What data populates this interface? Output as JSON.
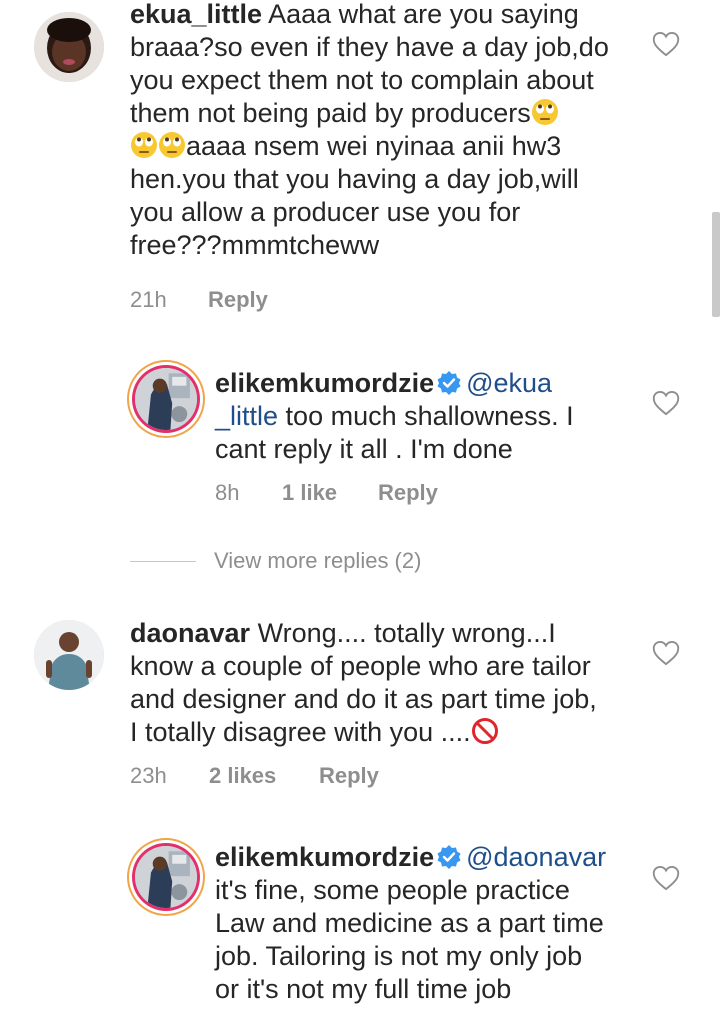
{
  "comments": [
    {
      "username": "ekua_little",
      "text_lines": [
        "Aaaa what are you saying",
        "braaa?so even if they have a day job,do",
        "you expect them not to complain about",
        "them not being paid by producers"
      ],
      "text_lines_2": [
        "aaaa nsem wei nyinaa anii hw3",
        "hen.you that you having a day job,will",
        "you allow a producer use you for",
        "free???mmmtcheww"
      ],
      "time": "21h",
      "reply_label": "Reply"
    },
    {
      "username": "elikemkumordzie",
      "mention": "@ekua",
      "mention_cont": "_little",
      "text_a": "too much shallowness. I",
      "text_b": "cant reply it all . I'm done",
      "time": "8h",
      "likes": "1 like",
      "reply_label": "Reply"
    },
    {
      "username": "daonavar",
      "text_lines": [
        "Wrong.... totally wrong...I",
        "know a couple of people who are tailor",
        "and designer and do it as part time job,",
        "I totally disagree  with you ...."
      ],
      "time": "23h",
      "likes": "2 likes",
      "reply_label": "Reply"
    },
    {
      "username": "elikemkumordzie",
      "mention": "@daonavar",
      "text_lines": [
        "it's fine, some people practice",
        "Law and medicine as a part time",
        "job. Tailoring is not my only job",
        "or it's not my full time job"
      ]
    }
  ],
  "view_more": "View more replies (2)",
  "icons": {
    "like": "heart-outline-icon",
    "verified": "verified-badge-icon",
    "eye_roll": "face-with-rolling-eyes-emoji",
    "prohibited": "prohibited-emoji"
  },
  "colors": {
    "text": "#262626",
    "meta": "#8e8e8e",
    "mention": "#1f4f8a",
    "verified": "#3897f0"
  }
}
